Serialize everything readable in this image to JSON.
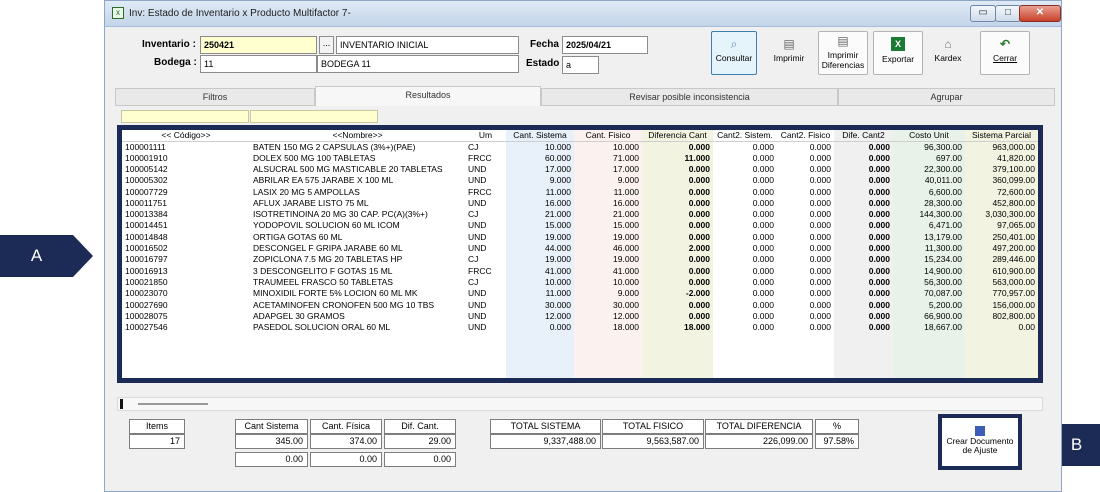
{
  "window": {
    "title": "Inv: Estado de Inventario x Producto Multifactor 7-",
    "minimize": "▭",
    "maximize": "□",
    "close": "✕"
  },
  "form": {
    "inventario_label": "Inventario :",
    "inventario_value": "250421",
    "lookup_button": "...",
    "inventario_desc": "INVENTARIO INICIAL",
    "bodega_label": "Bodega :",
    "bodega_value": "11",
    "bodega_desc": "BODEGA 11",
    "fecha_label": "Fecha",
    "fecha_value": "2025/04/21",
    "estado_label": "Estado",
    "estado_value": "a"
  },
  "toolbar": {
    "consultar": "Consultar",
    "imprimir": "Imprimir",
    "imprimir_diferencias": "Imprimir Diferencias",
    "exportar": "Exportar",
    "kardex": "Kardex",
    "cerrar": "Cerrar"
  },
  "tabs": [
    "Filtros",
    "Resultados",
    "Revisar posible inconsistencia",
    "Agrupar"
  ],
  "grid": {
    "columns": [
      "<< Código>>",
      "<<Nombre>>",
      "Um",
      "Cant. Sistema",
      "Cant. Fisico",
      "Diferencia Cant",
      "Cant2. Sistem.",
      "Cant2. Fisico",
      "Dife. Cant2",
      "Costo Unit",
      "Sistema Parcial"
    ],
    "rows": [
      [
        "100001111",
        "BATEN 150 MG 2 CAPSULAS (3%+)(PAE)",
        "CJ",
        "10.000",
        "10.000",
        "0.000",
        "0.000",
        "0.000",
        "0.000",
        "96,300.00",
        "963,000.00"
      ],
      [
        "100001910",
        "DOLEX 500 MG 100 TABLETAS",
        "FRCC",
        "60.000",
        "71.000",
        "11.000",
        "0.000",
        "0.000",
        "0.000",
        "697.00",
        "41,820.00"
      ],
      [
        "100005142",
        "ALSUCRAL 500 MG MASTICABLE 20 TABLETAS",
        "UND",
        "17.000",
        "17.000",
        "0.000",
        "0.000",
        "0.000",
        "0.000",
        "22,300.00",
        "379,100.00"
      ],
      [
        "100005302",
        "ABRILAR EA 575 JARABE X 100 ML",
        "UND",
        "9.000",
        "9.000",
        "0.000",
        "0.000",
        "0.000",
        "0.000",
        "40,011.00",
        "360,099.00"
      ],
      [
        "100007729",
        "LASIX 20 MG 5 AMPOLLAS",
        "FRCC",
        "11.000",
        "11.000",
        "0.000",
        "0.000",
        "0.000",
        "0.000",
        "6,600.00",
        "72,600.00"
      ],
      [
        "100011751",
        "AFLUX JARABE LISTO 75 ML",
        "UND",
        "16.000",
        "16.000",
        "0.000",
        "0.000",
        "0.000",
        "0.000",
        "28,300.00",
        "452,800.00"
      ],
      [
        "100013384",
        "ISOTRETINOINA 20 MG 30 CAP. PC(A)(3%+)",
        "CJ",
        "21.000",
        "21.000",
        "0.000",
        "0.000",
        "0.000",
        "0.000",
        "144,300.00",
        "3,030,300.00"
      ],
      [
        "100014451",
        "YODOPOVIL SOLUCION 60 ML ICOM",
        "UND",
        "15.000",
        "15.000",
        "0.000",
        "0.000",
        "0.000",
        "0.000",
        "6,471.00",
        "97,065.00"
      ],
      [
        "100014848",
        "ORTIGA GOTAS 60 ML",
        "UND",
        "19.000",
        "19.000",
        "0.000",
        "0.000",
        "0.000",
        "0.000",
        "13,179.00",
        "250,401.00"
      ],
      [
        "100016502",
        "DESCONGEL F GRIPA JARABE 60 ML",
        "UND",
        "44.000",
        "46.000",
        "2.000",
        "0.000",
        "0.000",
        "0.000",
        "11,300.00",
        "497,200.00"
      ],
      [
        "100016797",
        "ZOPICLONA 7.5 MG 20 TABLETAS HP",
        "CJ",
        "19.000",
        "19.000",
        "0.000",
        "0.000",
        "0.000",
        "0.000",
        "15,234.00",
        "289,446.00"
      ],
      [
        "100016913",
        "3 DESCONGELITO F GOTAS 15 ML",
        "FRCC",
        "41.000",
        "41.000",
        "0.000",
        "0.000",
        "0.000",
        "0.000",
        "14,900.00",
        "610,900.00"
      ],
      [
        "100021850",
        "TRAUMEEL FRASCO 50 TABLETAS",
        "CJ",
        "10.000",
        "10.000",
        "0.000",
        "0.000",
        "0.000",
        "0.000",
        "56,300.00",
        "563,000.00"
      ],
      [
        "100023070",
        "MINOXIDIL FORTE 5% LOCION 60 ML MK",
        "UND",
        "11.000",
        "9.000",
        "-2.000",
        "0.000",
        "0.000",
        "0.000",
        "70,087.00",
        "770,957.00"
      ],
      [
        "100027690",
        "ACETAMINOFEN CRONOFEN 500 MG 10 TBS",
        "UND",
        "30.000",
        "30.000",
        "0.000",
        "0.000",
        "0.000",
        "0.000",
        "5,200.00",
        "156,000.00"
      ],
      [
        "100028075",
        "ADAPGEL 30 GRAMOS",
        "UND",
        "12.000",
        "12.000",
        "0.000",
        "0.000",
        "0.000",
        "0.000",
        "66,900.00",
        "802,800.00"
      ],
      [
        "100027546",
        "PASEDOL SOLUCION ORAL 60 ML",
        "UND",
        "0.000",
        "18.000",
        "18.000",
        "0.000",
        "0.000",
        "0.000",
        "18,667.00",
        "0.00"
      ]
    ]
  },
  "summary": {
    "items_label": "Items",
    "items_value": "17",
    "cant_sistema_label": "Cant Sistema",
    "cant_fisica_label": "Cant. Física",
    "dif_cant_label": "Dif. Cant.",
    "cant_sistema_1": "345.00",
    "cant_fisica_1": "374.00",
    "dif_cant_1": "29.00",
    "cant_sistema_2": "0.00",
    "cant_fisica_2": "0.00",
    "dif_cant_2": "0.00",
    "total_sistema_label": "TOTAL SISTEMA",
    "total_fisico_label": "TOTAL FISICO",
    "total_diferencia_label": "TOTAL DIFERENCIA",
    "pct_label": "%",
    "total_sistema": "9,337,488.00",
    "total_fisico": "9,563,587.00",
    "total_diferencia": "226,099.00",
    "pct": "97.58%"
  },
  "create_button": "Crear Documento de Ajuste",
  "callouts": {
    "a": "A",
    "b": "B"
  }
}
